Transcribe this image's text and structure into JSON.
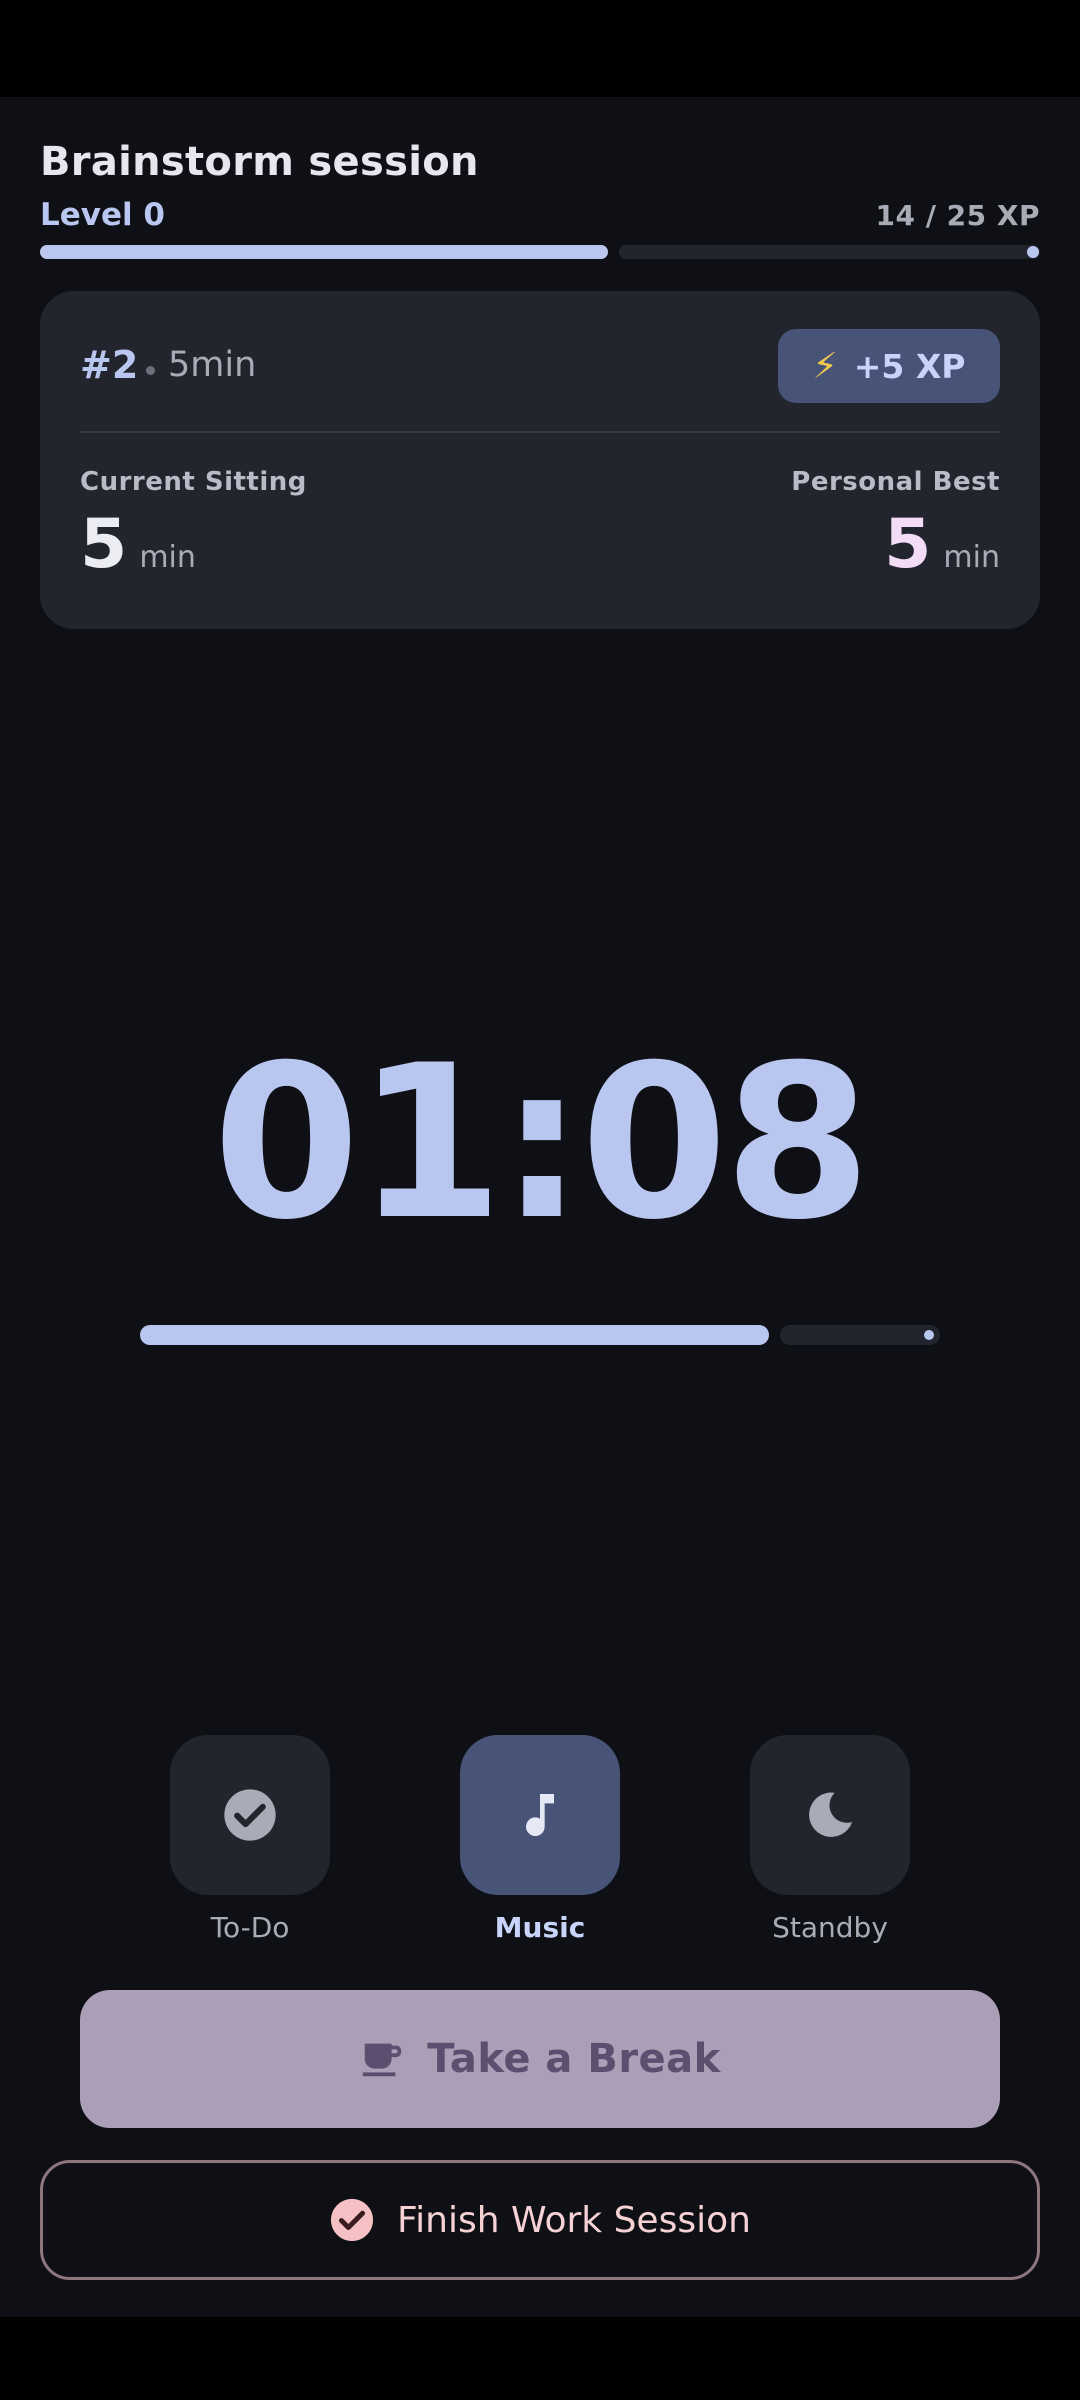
{
  "session": {
    "title": "Brainstorm session",
    "level_label": "Level 0",
    "xp_progress_label": "14 / 25 XP",
    "xp_current": 14,
    "xp_goal": 25
  },
  "card": {
    "session_number": "#2",
    "session_duration": "5min",
    "xp_reward": "+5 XP",
    "current_sitting_label": "Current Sitting",
    "current_sitting_value": "5",
    "current_sitting_unit": "min",
    "personal_best_label": "Personal Best",
    "personal_best_value": "5",
    "personal_best_unit": "min"
  },
  "timer": {
    "display": "01:08",
    "progress_fraction": 0.8
  },
  "actions": [
    {
      "label": "To-Do",
      "icon": "check-circle-icon",
      "active": false
    },
    {
      "label": "Music",
      "icon": "music-note-icon",
      "active": true
    },
    {
      "label": "Standby",
      "icon": "moon-icon",
      "active": false
    }
  ],
  "buttons": {
    "break_label": "Take a Break",
    "finish_label": "Finish Work Session"
  },
  "colors": {
    "accent": "#b9c6f0",
    "background": "#0e1015",
    "card": "#22252d",
    "active_tile": "#475478",
    "break_button": "#aa9fb7",
    "finish_text": "#f6d2d4"
  }
}
